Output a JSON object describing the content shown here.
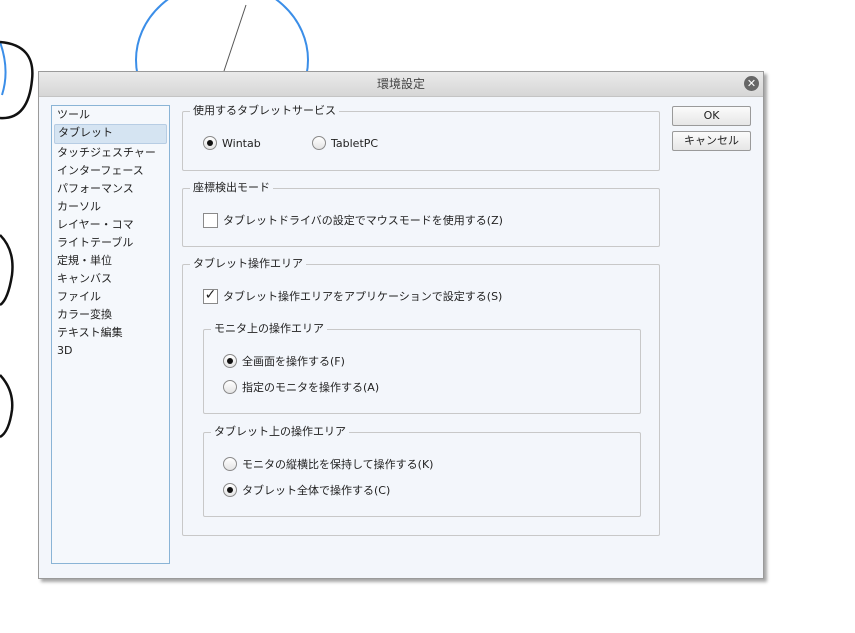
{
  "dialog": {
    "title": "環境設定",
    "ok": "OK",
    "cancel": "キャンセル"
  },
  "sidebar": {
    "items": [
      "ツール",
      "タブレット",
      "タッチジェスチャー",
      "インターフェース",
      "パフォーマンス",
      "カーソル",
      "レイヤー・コマ",
      "ライトテーブル",
      "定規・単位",
      "キャンバス",
      "ファイル",
      "カラー変換",
      "テキスト編集",
      "3D"
    ],
    "selected": "タブレット"
  },
  "service": {
    "title": "使用するタブレットサービス",
    "wintab": "Wintab",
    "tabletpc": "TabletPC",
    "selected": "Wintab"
  },
  "coord": {
    "title": "座標検出モード",
    "mouse_mode": "タブレットドライバの設定でマウスモードを使用する(Z)",
    "mouse_mode_checked": false
  },
  "area": {
    "title": "タブレット操作エリア",
    "app_setting": "タブレット操作エリアをアプリケーションで設定する(S)",
    "app_setting_checked": true,
    "monitor": {
      "title": "モニタ上の操作エリア",
      "full": "全画面を操作する(F)",
      "specific": "指定のモニタを操作する(A)",
      "selected": "full"
    },
    "tablet": {
      "title": "タブレット上の操作エリア",
      "keep_ratio": "モニタの縦横比を保持して操作する(K)",
      "whole": "タブレット全体で操作する(C)",
      "selected": "whole"
    }
  }
}
